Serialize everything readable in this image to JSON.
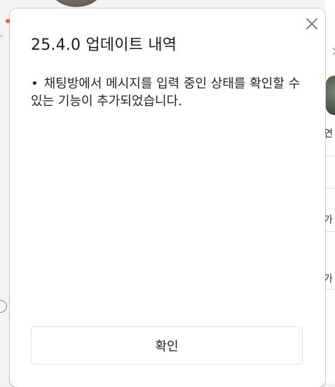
{
  "modal": {
    "title": "25.4.0 업데이트 내역",
    "notes": [
      "채팅방에서 메시지를 입력 중인 상태를 확인할 수 있는 기능이 추가되었습니다."
    ],
    "confirm_label": "확인",
    "close_icon": "close-icon"
  },
  "background": {
    "right_texts": [
      "연",
      "가",
      "가"
    ]
  }
}
